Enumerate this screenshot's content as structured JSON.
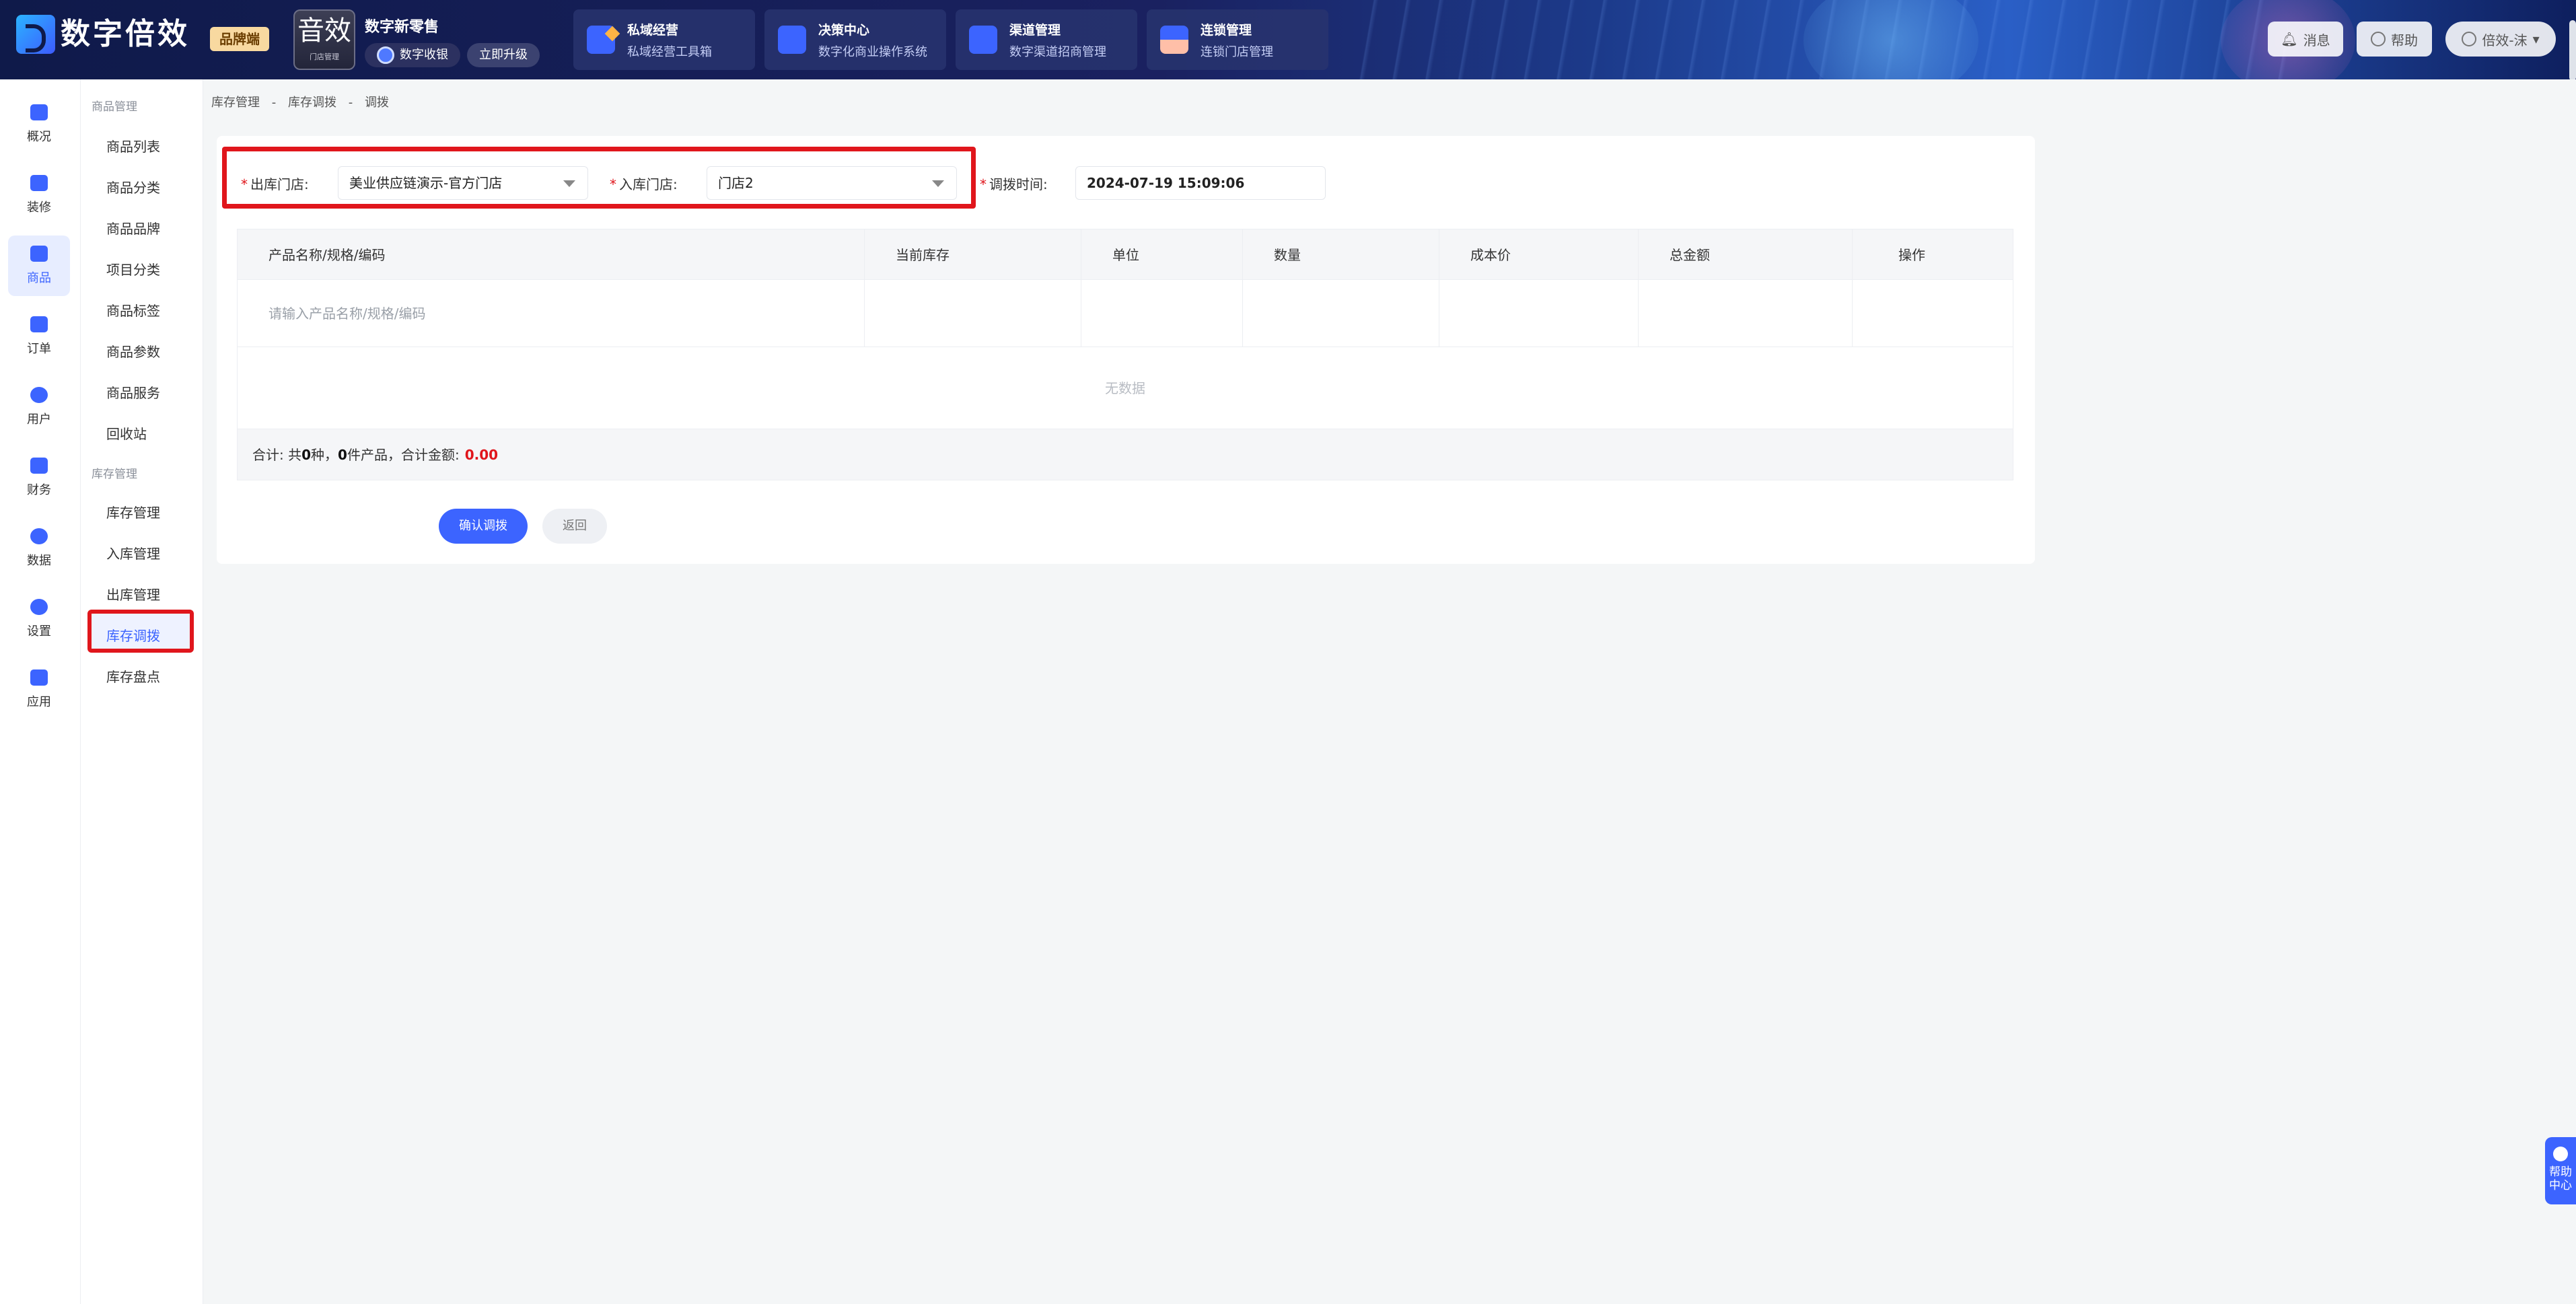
{
  "header": {
    "logo_title": "数字倍效",
    "brand_tag": "品牌端",
    "app_card": {
      "big": "音效",
      "small": "门店管理"
    },
    "retail": {
      "title": "数字新零售",
      "cashier": "数字收银",
      "upgrade": "立即升级"
    },
    "nav_cards": [
      {
        "title": "私域经营",
        "subtitle": "私域经营工具箱"
      },
      {
        "title": "决策中心",
        "subtitle": "数字化商业操作系统"
      },
      {
        "title": "渠道管理",
        "subtitle": "数字渠道招商管理"
      },
      {
        "title": "连锁管理",
        "subtitle": "连锁门店管理"
      }
    ],
    "message_label": "消息",
    "help_label": "帮助",
    "user_label": "倍效-沫"
  },
  "rail": [
    {
      "label": "概况"
    },
    {
      "label": "装修"
    },
    {
      "label": "商品"
    },
    {
      "label": "订单"
    },
    {
      "label": "用户"
    },
    {
      "label": "财务"
    },
    {
      "label": "数据"
    },
    {
      "label": "设置"
    },
    {
      "label": "应用"
    }
  ],
  "submenu": {
    "group1": "商品管理",
    "items1": [
      "商品列表",
      "商品分类",
      "商品品牌",
      "项目分类",
      "商品标签",
      "商品参数",
      "商品服务",
      "回收站"
    ],
    "group2": "库存管理",
    "items2": [
      "库存管理",
      "入库管理",
      "出库管理",
      "库存调拨",
      "库存盘点"
    ]
  },
  "breadcrumb": [
    "库存管理",
    "-",
    "库存调拨",
    "-",
    "调拨"
  ],
  "form": {
    "out_store_label": "出库门店:",
    "out_store_value": "美业供应链演示-官方门店",
    "in_store_label": "入库门店:",
    "in_store_value": "门店2",
    "time_label": "调拨时间:",
    "time_value": "2024-07-19 15:09:06",
    "required_mark": "*"
  },
  "table": {
    "headers": [
      "产品名称/规格/编码",
      "当前库存",
      "单位",
      "数量",
      "成本价",
      "总金额",
      "操作"
    ],
    "input_placeholder": "请输入产品名称/规格/编码",
    "empty_text": "无数据",
    "total_prefix": "合计: 共",
    "total_kinds": "0",
    "total_mid": "种，",
    "total_items": "0",
    "total_suffix": "件产品，合计金额:",
    "total_amount": "0.00"
  },
  "actions": {
    "confirm": "确认调拨",
    "back": "返回"
  },
  "help_float": {
    "line1": "帮助",
    "line2": "中心"
  }
}
